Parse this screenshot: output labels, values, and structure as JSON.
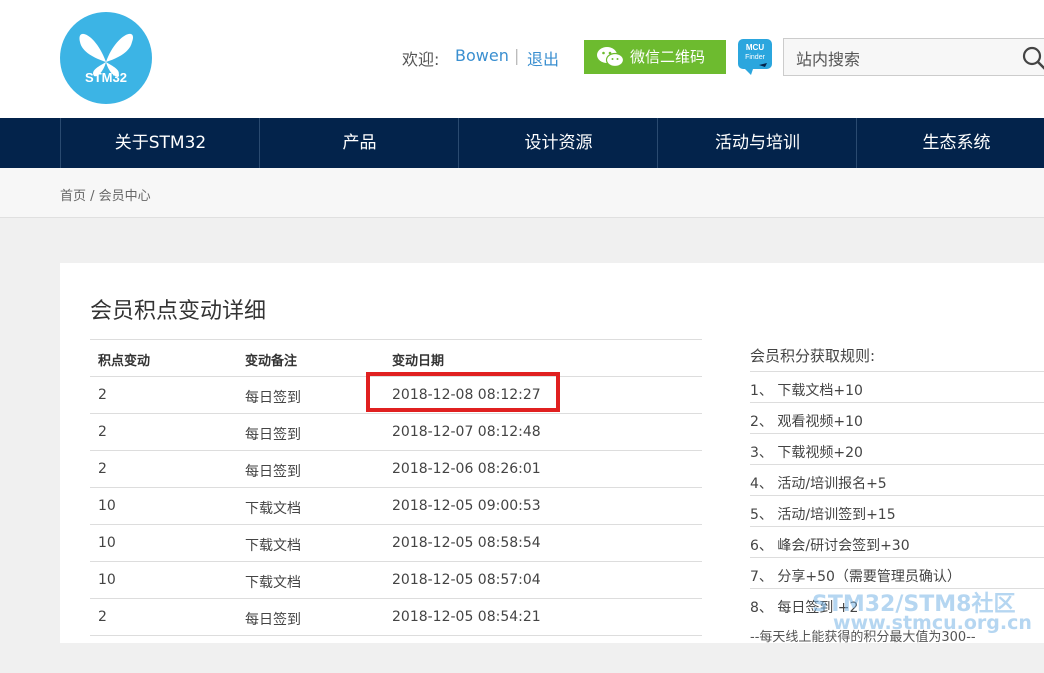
{
  "header": {
    "logo_text": "STM32",
    "welcome_label": "欢迎:",
    "username": "Bowen",
    "separator": "|",
    "logout_label": "退出",
    "wechat_label": "微信二维码",
    "mcu_finder_line1": "MCU",
    "mcu_finder_line2": "Finder",
    "search_placeholder": "站内搜索"
  },
  "nav": {
    "items": [
      {
        "label": "关于STM32"
      },
      {
        "label": "产品"
      },
      {
        "label": "设计资源"
      },
      {
        "label": "活动与培训"
      },
      {
        "label": "生态系统"
      }
    ]
  },
  "breadcrumb": "首页 / 会员中心",
  "main": {
    "title": "会员积点变动详细",
    "table": {
      "headers": [
        "积点变动",
        "变动备注",
        "变动日期"
      ],
      "rows": [
        [
          "2",
          "每日签到",
          "2018-12-08 08:12:27"
        ],
        [
          "2",
          "每日签到",
          "2018-12-07 08:12:48"
        ],
        [
          "2",
          "每日签到",
          "2018-12-06 08:26:01"
        ],
        [
          "10",
          "下载文档",
          "2018-12-05 09:00:53"
        ],
        [
          "10",
          "下载文档",
          "2018-12-05 08:58:54"
        ],
        [
          "10",
          "下载文档",
          "2018-12-05 08:57:04"
        ],
        [
          "2",
          "每日签到",
          "2018-12-05 08:54:21"
        ]
      ]
    }
  },
  "rules": {
    "title": "会员积分获取规则:",
    "items": [
      "1、 下载文档+10",
      "2、 观看视频+10",
      "3、 下载视频+20",
      "4、 活动/培训报名+5",
      "5、 活动/培训签到+15",
      "6、 峰会/研讨会签到+30",
      "7、 分享+50（需要管理员确认）",
      "8、 每日签到 +2"
    ],
    "note": "--每天线上能获得的积分最大值为300--"
  },
  "watermark": {
    "line1": "STM32/STM8社区",
    "line2": "www.stmcu.org.cn"
  },
  "colors": {
    "nav_bg": "#03234b",
    "wechat_green": "#6dbb2f",
    "logo_blue": "#3cb4e5",
    "link_blue": "#3a8fd0",
    "highlight_red": "#e02020"
  }
}
